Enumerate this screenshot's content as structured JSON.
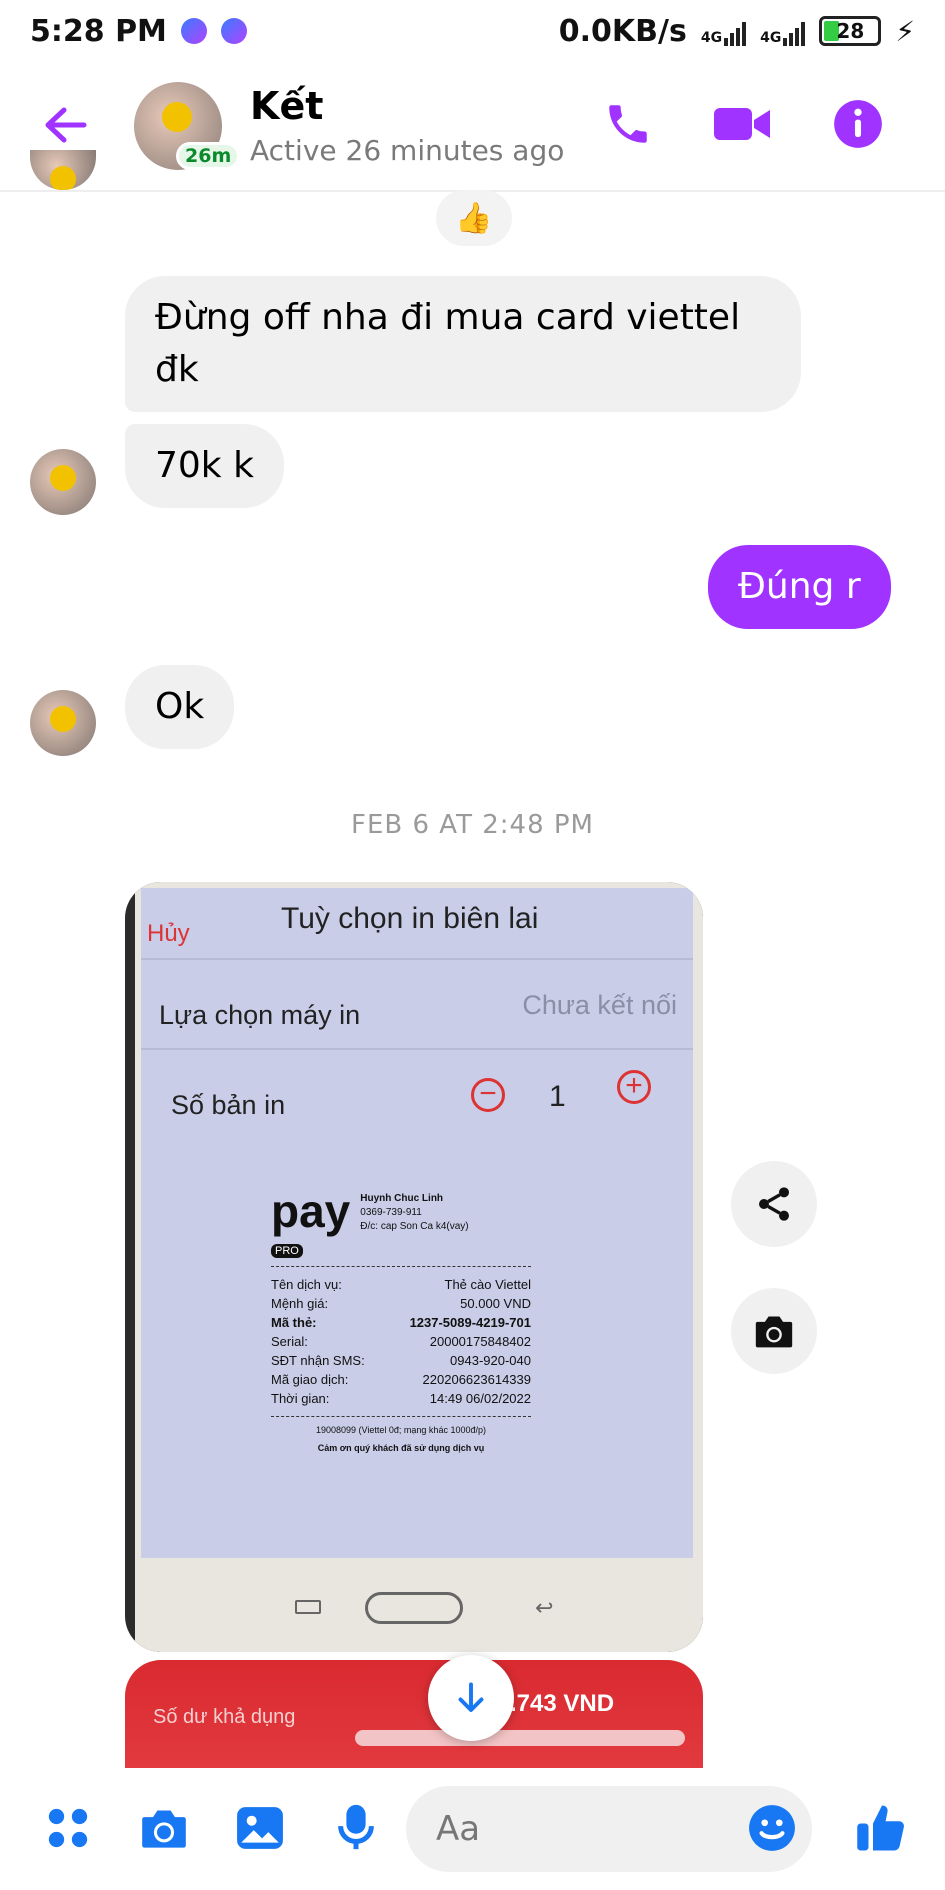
{
  "status_bar": {
    "time": "5:28 PM",
    "speed": "0.0KB/s",
    "network1": "4G",
    "network2": "4G",
    "battery": "28"
  },
  "header": {
    "name": "Kết",
    "active_badge": "26m",
    "active_status": "Active 26 minutes ago"
  },
  "messages": [
    {
      "from": "them",
      "text": "Đừng off nha đi mua card viettel đk"
    },
    {
      "from": "them",
      "text": "70k k"
    },
    {
      "from": "me",
      "text": "Đúng r"
    },
    {
      "from": "them",
      "text": "Ok"
    }
  ],
  "date_separator": "FEB 6 AT 2:48 PM",
  "photo": {
    "screen_title": "Tuỳ chọn in biên lai",
    "cancel": "Hủy",
    "printer_label": "Lựa chọn máy in",
    "printer_value": "Chưa kết nối",
    "copies_label": "Số bản in",
    "copies_value": "1",
    "receipt": {
      "brand": "pay",
      "brand_sub": "PRO",
      "merchant": "Huynh Chuc Linh",
      "merchant_phone": "0369-739-911",
      "merchant_addr": "Đ/c: cap Son Ca k4(vay)",
      "rows": [
        {
          "k": "Tên dịch vụ:",
          "v": "Thẻ cào Viettel"
        },
        {
          "k": "Mệnh giá:",
          "v": "50.000 VND"
        },
        {
          "k": "Mã thẻ:",
          "v": "1237-5089-4219-701"
        },
        {
          "k": "Serial:",
          "v": "20000175848402"
        },
        {
          "k": "SĐT nhận SMS:",
          "v": "0943-920-040"
        },
        {
          "k": "Mã giao dịch:",
          "v": "220206623614339"
        },
        {
          "k": "Thời gian:",
          "v": "14:49 06/02/2022"
        }
      ],
      "hotline": "19008099 (Viettel 0đ; mạng khác 1000đ/p)",
      "thanks": "Cảm ơn quý khách đã sử dụng dịch vụ"
    }
  },
  "photo2": {
    "label": "Số dư khả dụng",
    "amount": ".743 VND"
  },
  "composer": {
    "placeholder": "Aa"
  },
  "colors": {
    "accent": "#a033ff",
    "composer_icons": "#1877f2"
  }
}
